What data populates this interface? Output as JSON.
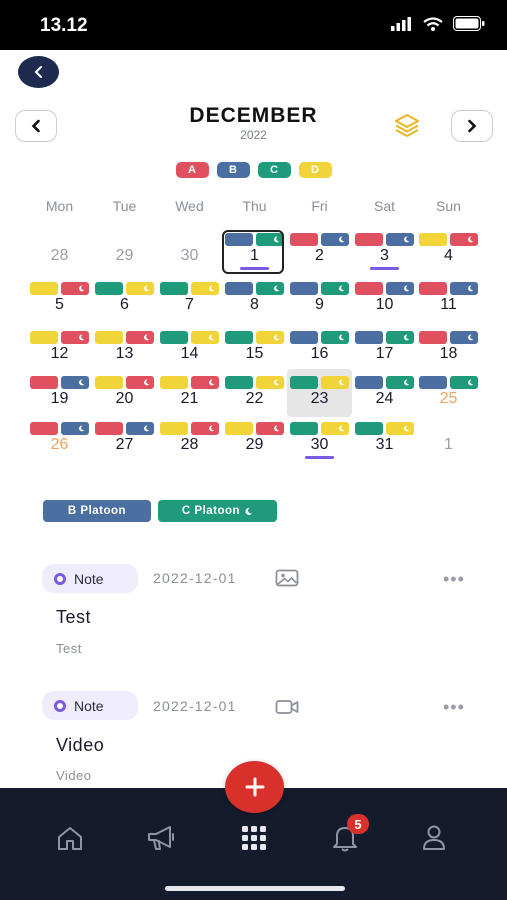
{
  "status_bar": {
    "time": "13.12"
  },
  "header": {
    "month": "DECEMBER",
    "year": "2022"
  },
  "colors": {
    "A": "#e0505f",
    "B": "#4a6fa0",
    "C": "#1f9a7a",
    "D": "#f0d438",
    "accent": "#7a5ae0",
    "nav_bg": "#131b2d",
    "fab": "#d8312c"
  },
  "legend": [
    {
      "label": "A",
      "color": "#e0505f"
    },
    {
      "label": "B",
      "color": "#4a6fa0"
    },
    {
      "label": "C",
      "color": "#1f9a7a"
    },
    {
      "label": "D",
      "color": "#f0d438"
    }
  ],
  "weekdays": [
    "Mon",
    "Tue",
    "Wed",
    "Thu",
    "Fri",
    "Sat",
    "Sun"
  ],
  "calendar": {
    "weeks": [
      [
        {
          "day": "28",
          "muted": true,
          "shifts": []
        },
        {
          "day": "29",
          "muted": true,
          "shifts": []
        },
        {
          "day": "30",
          "muted": true,
          "shifts": []
        },
        {
          "day": "1",
          "shifts": [
            "B",
            "C"
          ],
          "today": true,
          "event": true
        },
        {
          "day": "2",
          "shifts": [
            "A",
            "B"
          ]
        },
        {
          "day": "3",
          "shifts": [
            "A",
            "B"
          ],
          "event": true
        },
        {
          "day": "4",
          "shifts": [
            "D",
            "A"
          ]
        }
      ],
      [
        {
          "day": "5",
          "shifts": [
            "D",
            "A"
          ]
        },
        {
          "day": "6",
          "shifts": [
            "C",
            "D"
          ]
        },
        {
          "day": "7",
          "shifts": [
            "C",
            "D"
          ]
        },
        {
          "day": "8",
          "shifts": [
            "B",
            "C"
          ]
        },
        {
          "day": "9",
          "shifts": [
            "B",
            "C"
          ]
        },
        {
          "day": "10",
          "shifts": [
            "A",
            "B"
          ]
        },
        {
          "day": "11",
          "shifts": [
            "A",
            "B"
          ]
        }
      ],
      [
        {
          "day": "12",
          "shifts": [
            "D",
            "A"
          ]
        },
        {
          "day": "13",
          "shifts": [
            "D",
            "A"
          ]
        },
        {
          "day": "14",
          "shifts": [
            "C",
            "D"
          ]
        },
        {
          "day": "15",
          "shifts": [
            "C",
            "D"
          ]
        },
        {
          "day": "16",
          "shifts": [
            "B",
            "C"
          ]
        },
        {
          "day": "17",
          "shifts": [
            "B",
            "C"
          ]
        },
        {
          "day": "18",
          "shifts": [
            "A",
            "B"
          ]
        }
      ],
      [
        {
          "day": "19",
          "shifts": [
            "A",
            "B"
          ]
        },
        {
          "day": "20",
          "shifts": [
            "D",
            "A"
          ]
        },
        {
          "day": "21",
          "shifts": [
            "D",
            "A"
          ]
        },
        {
          "day": "22",
          "shifts": [
            "C",
            "D"
          ]
        },
        {
          "day": "23",
          "shifts": [
            "C",
            "D"
          ],
          "selected": true
        },
        {
          "day": "24",
          "shifts": [
            "B",
            "C"
          ]
        },
        {
          "day": "25",
          "shifts": [
            "B",
            "C"
          ],
          "weekend": true
        }
      ],
      [
        {
          "day": "26",
          "shifts": [
            "A",
            "B"
          ],
          "weekend": true
        },
        {
          "day": "27",
          "shifts": [
            "A",
            "B"
          ]
        },
        {
          "day": "28",
          "shifts": [
            "D",
            "A"
          ]
        },
        {
          "day": "29",
          "shifts": [
            "D",
            "A"
          ]
        },
        {
          "day": "30",
          "shifts": [
            "C",
            "D"
          ],
          "event": true
        },
        {
          "day": "31",
          "shifts": [
            "C",
            "D"
          ]
        },
        {
          "day": "1",
          "muted": true,
          "shifts": []
        }
      ]
    ]
  },
  "platoons": [
    {
      "label": "B Platoon",
      "color": "#4a6fa0",
      "night": false
    },
    {
      "label": "C Platoon",
      "color": "#1f9a7a",
      "night": true
    }
  ],
  "notes": [
    {
      "type": "Note",
      "date": "2022-12-01",
      "media": "image-icon",
      "title": "Test",
      "subtitle": "Test",
      "more": "•••"
    },
    {
      "type": "Note",
      "date": "2022-12-01",
      "media": "video-icon",
      "title": "Video",
      "subtitle": "Video",
      "more": "•••"
    }
  ],
  "bottom_nav": {
    "items": [
      "home-icon",
      "megaphone-icon",
      "grid-icon",
      "bell-icon",
      "profile-icon"
    ],
    "notification_count": "5",
    "fab_label": "+"
  }
}
